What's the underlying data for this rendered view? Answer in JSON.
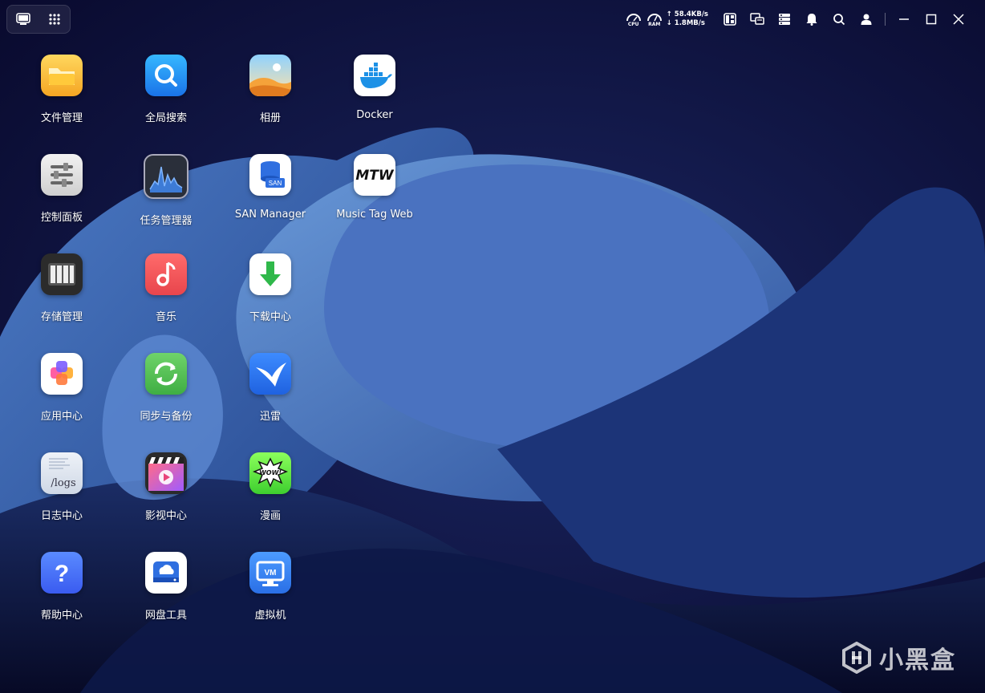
{
  "topbar": {
    "desktop_icon": "desktop-icon",
    "apps_grid_icon": "grid-icon",
    "cpu_label": "CPU",
    "ram_label": "RAM",
    "upload_speed": "↑ 58.4KB/s",
    "download_speed": "↓ 1.8MB/s",
    "icons": [
      "widget-panel-icon",
      "monitor-icon",
      "server-list-icon",
      "bell-icon",
      "search-icon",
      "user-icon",
      "minimize-icon",
      "maximize-icon",
      "close-icon"
    ]
  },
  "apps": [
    {
      "label": "文件管理",
      "icon": "folder-icon"
    },
    {
      "label": "全局搜索",
      "icon": "global-search-icon"
    },
    {
      "label": "相册",
      "icon": "photos-icon"
    },
    {
      "label": "Docker",
      "icon": "docker-icon"
    },
    {
      "label": "控制面板",
      "icon": "control-panel-icon"
    },
    {
      "label": "任务管理器",
      "icon": "task-manager-icon"
    },
    {
      "label": "SAN Manager",
      "icon": "san-manager-icon"
    },
    {
      "label": "Music Tag Web",
      "icon": "music-tag-icon"
    },
    {
      "label": "存储管理",
      "icon": "storage-icon"
    },
    {
      "label": "音乐",
      "icon": "music-icon"
    },
    {
      "label": "下载中心",
      "icon": "download-icon"
    },
    {
      "label": "应用中心",
      "icon": "app-center-icon"
    },
    {
      "label": "同步与备份",
      "icon": "sync-backup-icon"
    },
    {
      "label": "迅雷",
      "icon": "xunlei-icon"
    },
    {
      "label": "日志中心",
      "icon": "logs-icon"
    },
    {
      "label": "影视中心",
      "icon": "video-center-icon"
    },
    {
      "label": "漫画",
      "icon": "comics-icon"
    },
    {
      "label": "帮助中心",
      "icon": "help-icon"
    },
    {
      "label": "网盘工具",
      "icon": "cloud-drive-icon"
    },
    {
      "label": "虚拟机",
      "icon": "vm-icon"
    }
  ],
  "icon_text": {
    "san": "SAN",
    "mtw": "MTW",
    "logs": "/logs",
    "wow": "WOW!",
    "vm": "VM",
    "help": "?"
  },
  "watermark": "小黑盒",
  "colors": {
    "background": "#0b0b2e",
    "accent_blue": "#2f6fe0",
    "wallpaper_blue": "#3b63b0"
  }
}
